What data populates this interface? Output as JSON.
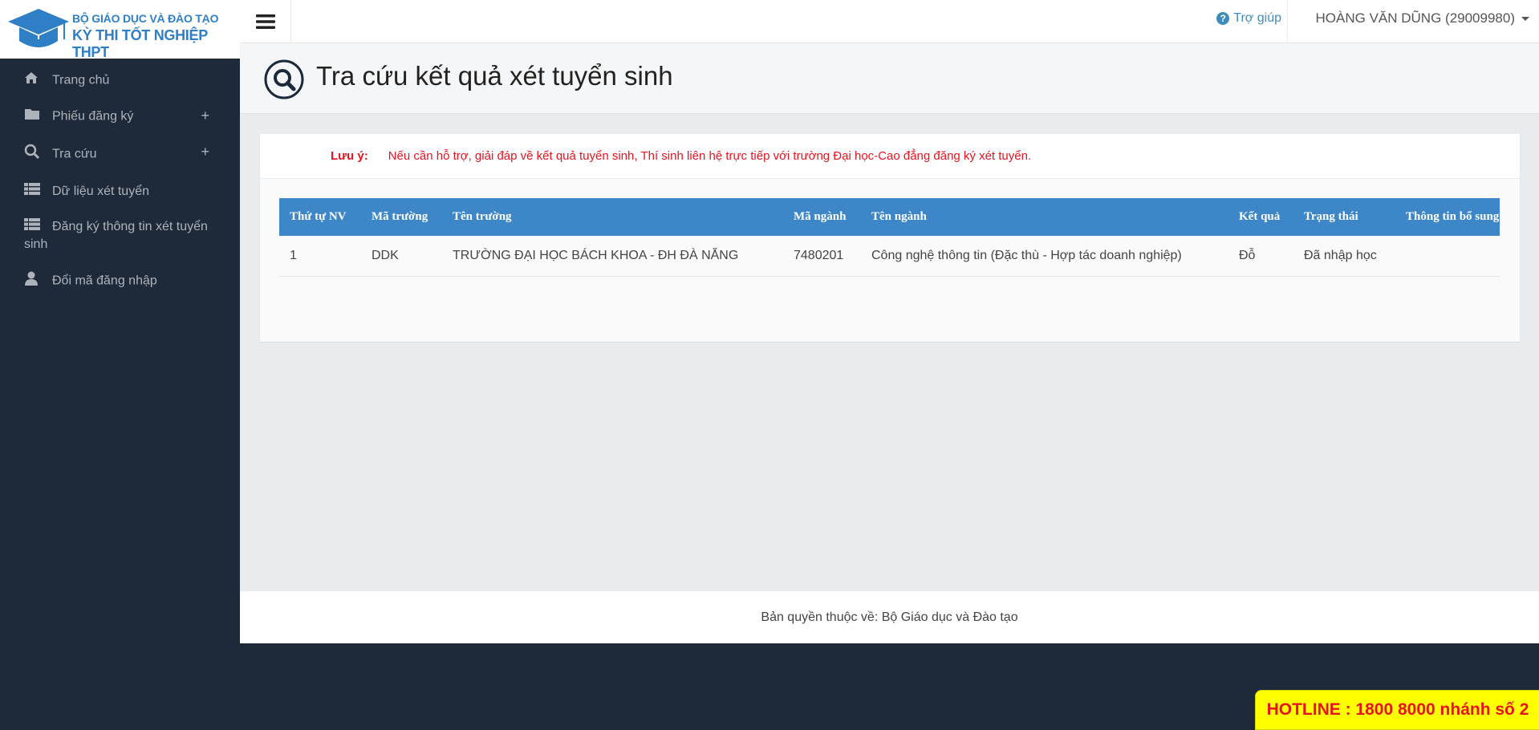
{
  "logo": {
    "line1": "BỘ GIÁO DỤC VÀ ĐÀO TẠO",
    "line2": "KỲ THI TỐT NGHIỆP THPT"
  },
  "sidebar": {
    "items": [
      {
        "label": "Trang chủ",
        "icon": "home-icon"
      },
      {
        "label": "Phiếu đăng ký",
        "icon": "folder-icon",
        "expand": "+"
      },
      {
        "label": "Tra cứu",
        "icon": "search-icon",
        "expand": "+"
      },
      {
        "label": "Dữ liệu xét tuyển",
        "icon": "list-icon"
      },
      {
        "label": "Đăng ký thông tin xét tuyển sinh",
        "icon": "list-icon"
      },
      {
        "label": "Đổi mã đăng nhập",
        "icon": "user-icon"
      }
    ]
  },
  "header": {
    "help_label": "Trợ giúp",
    "user_label": "HOÀNG VĂN DŨNG (29009980)"
  },
  "page": {
    "title": "Tra cứu kết quả xét tuyển sinh"
  },
  "notice": {
    "label": "Lưu ý:",
    "text": "Nếu cần hỗ trợ, giải đáp về kết quả tuyển sinh, Thí sinh liên hệ trực tiếp với trường Đại học-Cao đẳng đăng ký xét tuyển."
  },
  "table": {
    "columns": [
      "Thứ tự NV",
      "Mã trường",
      "Tên trường",
      "Mã ngành",
      "Tên ngành",
      "Kết quả",
      "Trạng thái",
      "Thông tin bổ sung"
    ],
    "rows": [
      [
        "1",
        "DDK",
        "TRƯỜNG ĐẠI HỌC BÁCH KHOA - ĐH ĐÀ NẴNG",
        "7480201",
        "Công nghệ thông tin (Đặc thù - Hợp tác doanh nghiệp)",
        "Đỗ",
        "Đã nhập học",
        ""
      ]
    ]
  },
  "footer": {
    "text": "Bản quyền thuộc về: Bộ Giáo dục và Đào tạo"
  },
  "hotline": {
    "text": "HOTLINE : 1800 8000 nhánh số 2"
  },
  "colors": {
    "sidebar_bg": "#1e2a3a",
    "accent": "#3d87c9",
    "notice_red": "#e8131e",
    "hotline_bg": "#ffff00"
  }
}
